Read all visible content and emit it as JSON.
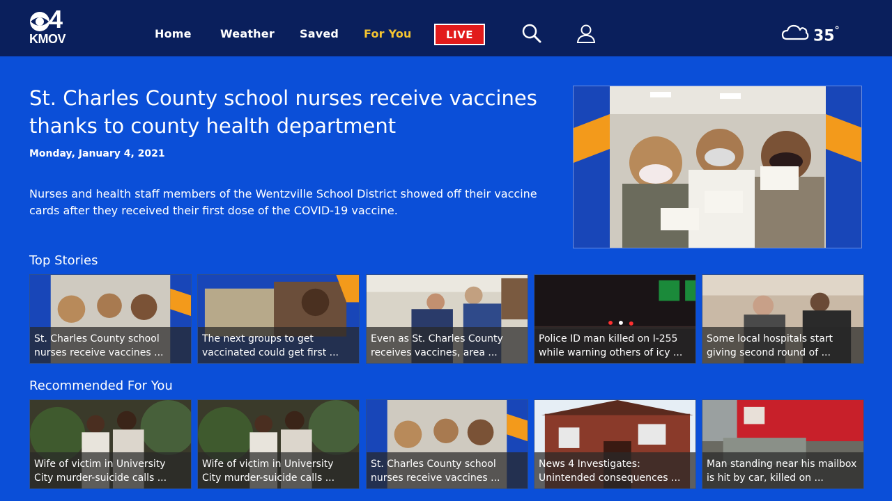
{
  "header": {
    "logo_number": "4",
    "logo_call": "KMOV",
    "nav": [
      {
        "label": "Home"
      },
      {
        "label": "Weather"
      },
      {
        "label": "Saved"
      },
      {
        "label": "For You",
        "active": true
      }
    ],
    "live_label": "LIVE",
    "search_icon": "search-icon",
    "account_icon": "account-icon",
    "weather_icon": "cloud-icon",
    "temperature": "35",
    "degree_symbol": "°"
  },
  "hero": {
    "title": "St. Charles County school nurses receive vaccines thanks to county health department",
    "date": "Monday, January 4, 2021",
    "summary": "Nurses and health staff members of the Wentzville School District showed off their vaccine cards after they received their first dose of the COVID-19 vaccine."
  },
  "top_stories": {
    "title": "Top Stories",
    "items": [
      {
        "line1": "St. Charles County school",
        "line2": "nurses receive vaccines ..."
      },
      {
        "line1": "The next groups to get",
        "line2": "vaccinated could get first ..."
      },
      {
        "line1": "Even as St. Charles County",
        "line2": "receives vaccines, area ..."
      },
      {
        "line1": "Police ID man killed on I-255",
        "line2": "while warning others of icy ..."
      },
      {
        "line1": "Some local hospitals start",
        "line2": "giving second round of ..."
      }
    ]
  },
  "recommended": {
    "title": "Recommended For You",
    "items": [
      {
        "line1": "Wife of victim in University",
        "line2": "City murder-suicide calls ..."
      },
      {
        "line1": "Wife of victim in University",
        "line2": "City murder-suicide calls ..."
      },
      {
        "line1": "St. Charles County school",
        "line2": "nurses receive vaccines ..."
      },
      {
        "line1": "News 4 Investigates:",
        "line2": "Unintended consequences ..."
      },
      {
        "line1": "Man standing near his mailbox",
        "line2": "is hit by car, killed on ..."
      }
    ]
  },
  "colors": {
    "background": "#0b4fd8",
    "header": "#0a1f5c",
    "active_nav": "#f5c431",
    "live": "#e21b1b"
  }
}
